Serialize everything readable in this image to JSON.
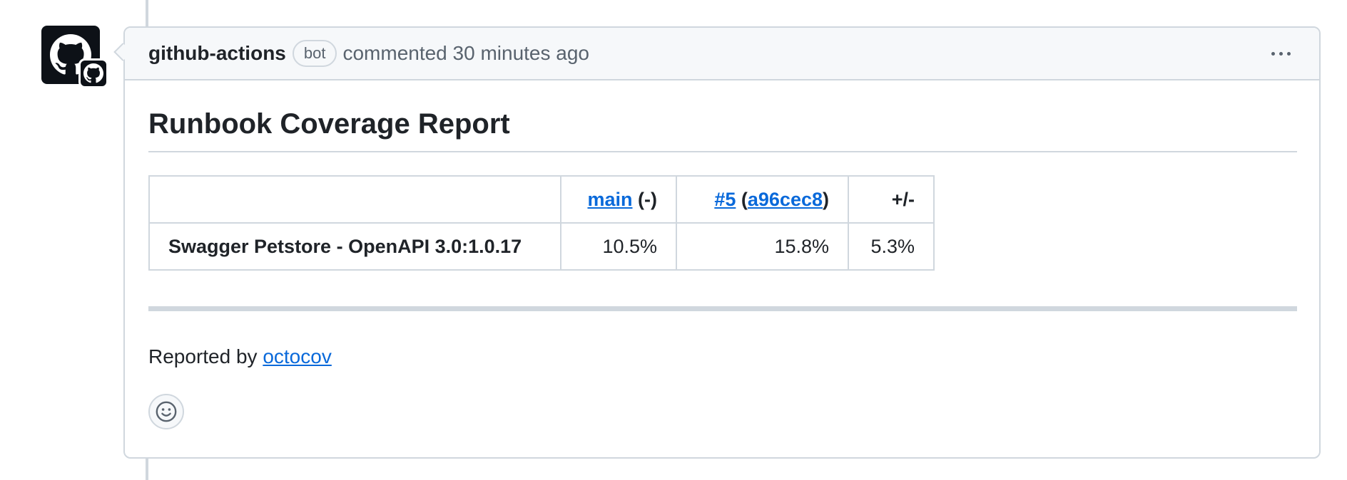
{
  "comment": {
    "author": "github-actions",
    "badge": "bot",
    "meta": "commented 30 minutes ago"
  },
  "report": {
    "title": "Runbook Coverage Report",
    "table": {
      "headers": {
        "base_branch": "main",
        "base_suffix": "(-)",
        "pr_number": "#5",
        "pr_open": "(",
        "pr_commit": "a96cec8",
        "pr_close": ")",
        "diff": "+/-"
      },
      "rows": [
        {
          "name": "Swagger Petstore - OpenAPI 3.0:1.0.17",
          "base": "10.5%",
          "pr": "15.8%",
          "diff": "5.3%"
        }
      ]
    },
    "footer_prefix": "Reported by",
    "footer_link": "octocov"
  },
  "icons": {
    "avatar": "github-octocat-icon",
    "badge": "github-octocat-icon",
    "more": "kebab-horizontal-icon",
    "reaction": "smiley-icon"
  },
  "colors": {
    "link": "#0969da",
    "border": "#d0d7de",
    "header_bg": "#f6f8fa",
    "muted": "#59636e"
  }
}
